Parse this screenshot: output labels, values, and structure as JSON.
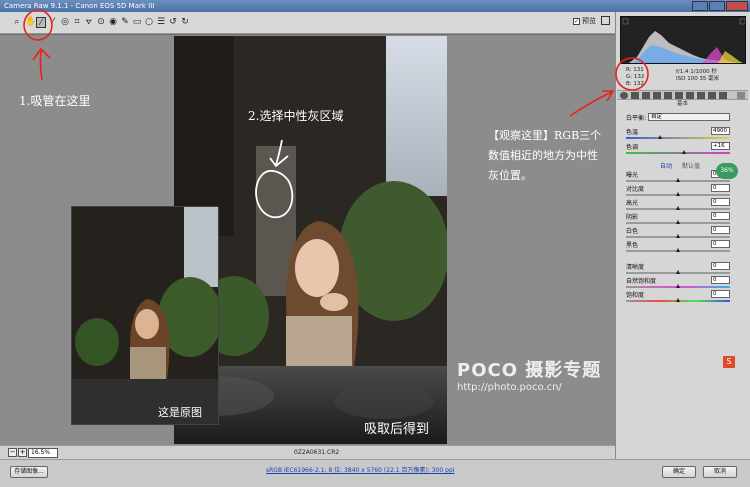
{
  "window": {
    "title": "Camera Raw 9.1.1 - Canon EOS 5D Mark III"
  },
  "toolbar": {
    "tools": [
      "zoom-icon",
      "hand-icon",
      "white-balance-eyedropper-icon",
      "color-sampler-icon",
      "targeted-adjustment-icon",
      "crop-icon",
      "straighten-icon",
      "spot-removal-icon",
      "red-eye-icon",
      "adjustment-brush-icon",
      "graduated-filter-icon",
      "radial-filter-icon",
      "preferences-icon",
      "rotate-left-icon",
      "rotate-right-icon"
    ],
    "preview_label": "预览",
    "preview_checked": true
  },
  "canvas": {
    "zoom": "16.5%",
    "filename": "0Z2A0631.CR2"
  },
  "footer": {
    "save_label": "存储图像...",
    "workflow_link": "sRGB IEC61966-2.1; 8 位; 3840 x 5760 (22.1 百万像素); 300 ppi",
    "ok_label": "确定",
    "cancel_label": "取消"
  },
  "info": {
    "r": "R: 131",
    "g": "G: 132",
    "b": "B: 132",
    "aperture_shutter": "f/1.4  1/1000 秒",
    "iso_focal": "ISO 100  35 毫米"
  },
  "panel": {
    "title": "基本",
    "wb_label": "白平衡:",
    "wb_value": "自定",
    "temp_label": "色温",
    "temp_value": "4900",
    "tint_label": "色调",
    "tint_value": "+16",
    "auto_label": "自动",
    "default_label": "默认值",
    "exposure_label": "曝光",
    "exposure_value": "0.00",
    "contrast_label": "对比度",
    "contrast_value": "0",
    "highlights_label": "高光",
    "highlights_value": "0",
    "shadows_label": "阴影",
    "shadows_value": "0",
    "whites_label": "白色",
    "whites_value": "0",
    "blacks_label": "黑色",
    "blacks_value": "0",
    "clarity_label": "清晰度",
    "clarity_value": "0",
    "vibrance_label": "自然饱和度",
    "vibrance_value": "0",
    "saturation_label": "饱和度",
    "saturation_value": "0"
  },
  "annotations": {
    "step1": "1.吸管在这里",
    "step2": "2.选择中性灰区域",
    "observe": "【观察这里】RGB三个数值相近的地方为中性灰位置。",
    "original_caption": "这是原图",
    "result_caption": "吸取后得到",
    "watermark_brand": "POCO 摄影专题",
    "watermark_url": "http://photo.poco.cn/",
    "badge": "36%"
  },
  "colors": {
    "annotation_red": "#e8231c",
    "toolbar_bg": "#d8d8d8",
    "canvas_bg": "#8c8c8c",
    "panel_bg": "#d6d6d6"
  }
}
